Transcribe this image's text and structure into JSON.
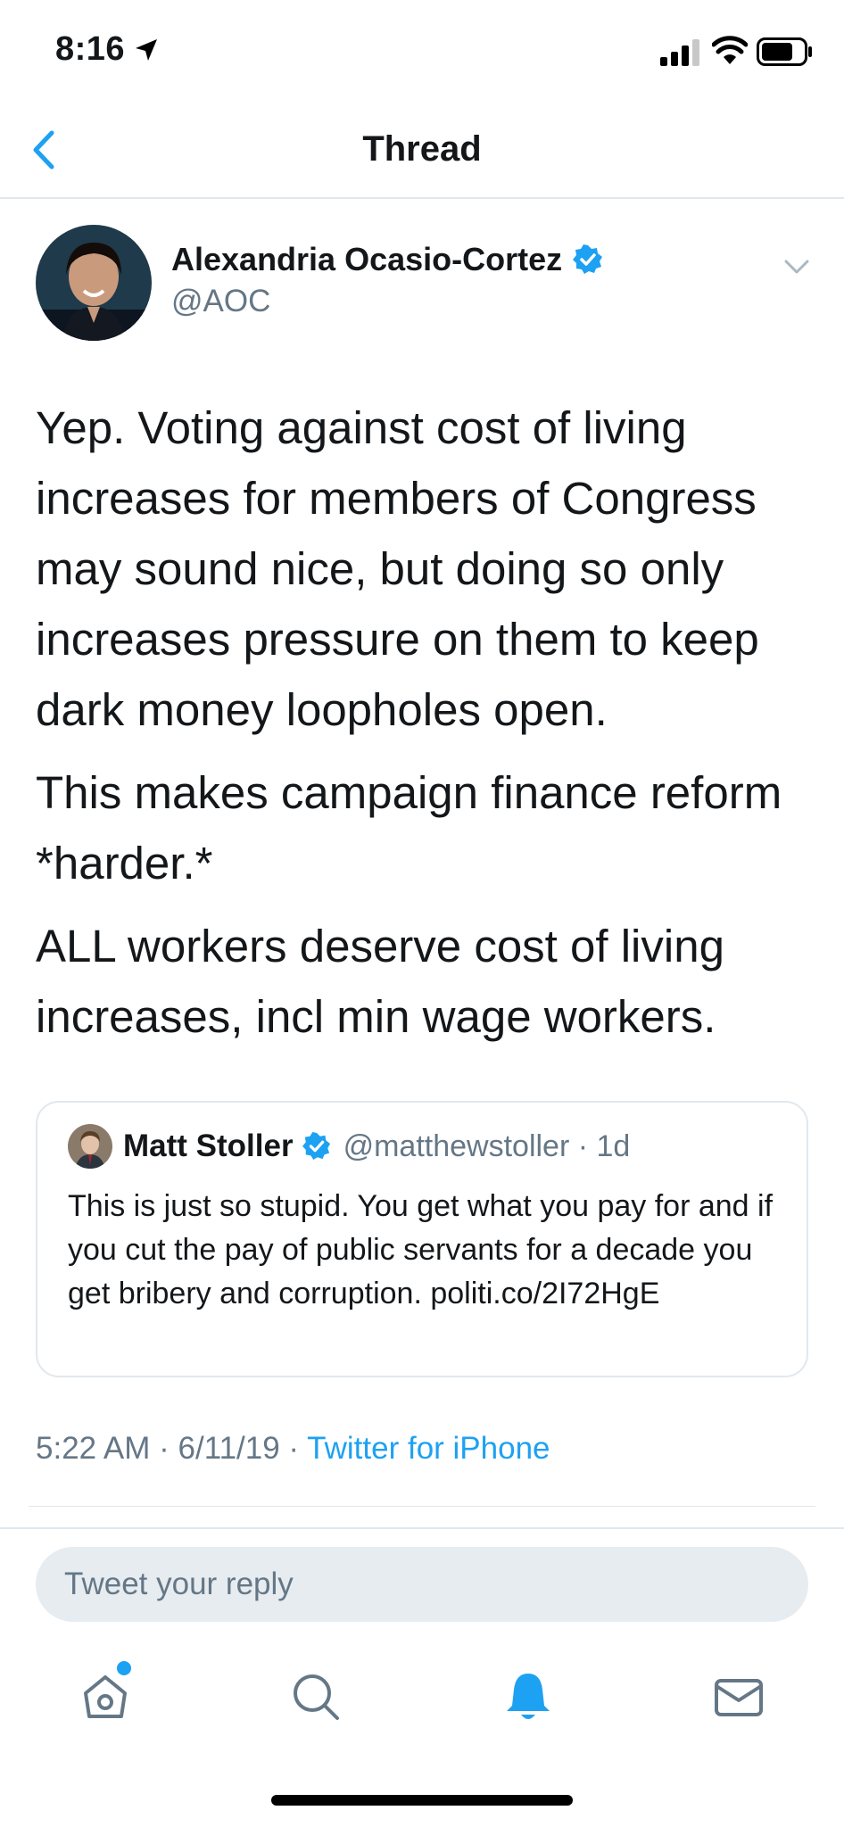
{
  "status_bar": {
    "time": "8:16"
  },
  "nav": {
    "title": "Thread"
  },
  "tweet": {
    "author_name": "Alexandria Ocasio-Cortez",
    "author_handle": "@AOC",
    "paragraphs": [
      "Yep. Voting against cost of living increases for members of Congress may sound nice, but doing so only increases pressure on them to keep dark money loopholes open.",
      "This makes campaign finance reform *harder.*",
      "ALL workers deserve cost of living increases, incl min wage workers."
    ],
    "timestamp": "5:22 AM · 6/11/19 · ",
    "source": "Twitter for iPhone"
  },
  "quoted_tweet": {
    "author_name": "Matt Stoller",
    "author_handle": "@matthewstoller · 1d",
    "text": "This is just so stupid. You get what you pay for and if you cut the pay of public servants for a decade you get bribery and corruption. politi.co/2I72HgE"
  },
  "reply": {
    "placeholder": "Tweet your reply"
  },
  "tab_bar": {
    "icons": [
      "home-icon",
      "search-icon",
      "bell-icon",
      "mail-icon"
    ],
    "active": "bell-icon"
  },
  "colors": {
    "accent": "#1da1f2",
    "text_primary": "#14171a",
    "text_secondary": "#657786",
    "border": "#e1e8ed",
    "reply_bg": "#e6ecf0"
  }
}
